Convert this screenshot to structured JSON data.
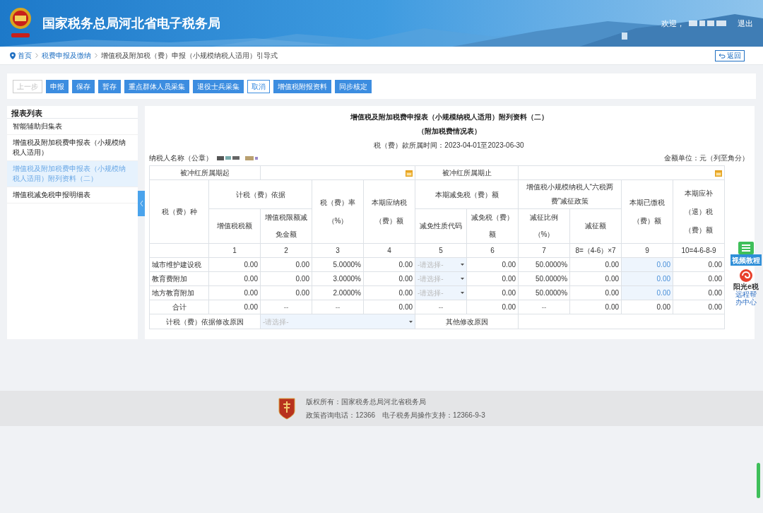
{
  "header": {
    "title": "国家税务总局河北省电子税务局",
    "welcome": "欢迎，",
    "logout": "退出"
  },
  "breadcrumb": [
    {
      "label": "首页",
      "link": true
    },
    {
      "label": "税费申报及缴纳",
      "link": true
    },
    {
      "label": "增值税及附加税（费）申报（小规模纳税人适用）引导式",
      "link": false
    }
  ],
  "back_button": "返回",
  "toolbar": [
    {
      "label": "上一步",
      "kind": "disabled"
    },
    {
      "label": "申报",
      "kind": "primary"
    },
    {
      "label": "保存",
      "kind": "primary"
    },
    {
      "label": "暂存",
      "kind": "primary"
    },
    {
      "label": "重点群体人员采集",
      "kind": "primary"
    },
    {
      "label": "退役士兵采集",
      "kind": "primary"
    },
    {
      "label": "取消",
      "kind": "outline"
    },
    {
      "label": "增值税附报资料",
      "kind": "primary"
    },
    {
      "label": "同步核定",
      "kind": "primary"
    }
  ],
  "sidebar": {
    "title": "报表列表",
    "items": [
      {
        "label": "智能辅助归集表",
        "selected": false
      },
      {
        "label": "增值税及附加税费申报表（小规模纳税人适用）",
        "selected": false
      },
      {
        "label": "增值税及附加税费申报表（小规模纳税人适用）附列资料（二）",
        "selected": true
      },
      {
        "label": "增值税减免税申报明细表",
        "selected": false
      }
    ]
  },
  "form": {
    "title": "增值税及附加税费申报表（小规模纳税人适用）附列资料（二）",
    "subtitle": "（附加税费情况表）",
    "period": "税（费）款所属时间：2023-04-01至2023-06-30",
    "taxpayer_label": "纳税人名称（公章）",
    "unit": "金额单位：元（列至角分）",
    "period_start_label": "被冲红所属期起",
    "period_end_label": "被冲红所属期止",
    "headers": {
      "tax_type": "税（费）种",
      "basis": "计税（费）依据",
      "vat_amount": "增值税税额",
      "vat_limit": "增值税限额减免金额",
      "rate": "税（费）率（%）",
      "payable": "本期应纳税（费）额",
      "reduction": "本期减免税（费）额",
      "reduction_code": "减免性质代码",
      "reduction_amount": "减免税（费）额",
      "policy": "增值税小规模纳税人“六税两费”减征政策",
      "policy_ratio": "减征比例（%）",
      "policy_amount": "减征额",
      "paid": "本期已缴税（费）额",
      "due": "本期应补（退）税（费）额"
    },
    "column_numbers": [
      "1",
      "2",
      "3",
      "4",
      "5",
      "6",
      "7",
      "8=（4-6）×7",
      "9",
      "10=4-6-8-9"
    ],
    "rows": [
      {
        "name": "城市维护建设税",
        "kind": "item",
        "cells": [
          "0.00",
          "0.00",
          "5.0000%",
          "0.00",
          "-请选择-",
          "0.00",
          "50.0000%",
          "0.00",
          "0.00",
          "0.00"
        ]
      },
      {
        "name": "教育费附加",
        "kind": "item",
        "cells": [
          "0.00",
          "0.00",
          "3.0000%",
          "0.00",
          "-请选择-",
          "0.00",
          "50.0000%",
          "0.00",
          "0.00",
          "0.00"
        ]
      },
      {
        "name": "地方教育附加",
        "kind": "item",
        "cells": [
          "0.00",
          "0.00",
          "2.0000%",
          "0.00",
          "-请选择-",
          "0.00",
          "50.0000%",
          "0.00",
          "0.00",
          "0.00"
        ]
      },
      {
        "name": "合计",
        "kind": "total",
        "cells": [
          "0.00",
          "--",
          "--",
          "0.00",
          "--",
          "0.00",
          "--",
          "0.00",
          "0.00",
          "0.00"
        ]
      }
    ],
    "reason_label": "计税（费）依据修改原因",
    "reason_placeholder": "-请选择-",
    "other_reason_label": "其他修改原因"
  },
  "float_tools": {
    "video": "视频教程",
    "brand": "阳光e税",
    "help": "远程帮办中心"
  },
  "footer": {
    "copyright": "版权所有：国家税务总局河北省税务局",
    "contact": "政策咨询电话：12366　电子税务局操作支持：12366-9-3"
  }
}
